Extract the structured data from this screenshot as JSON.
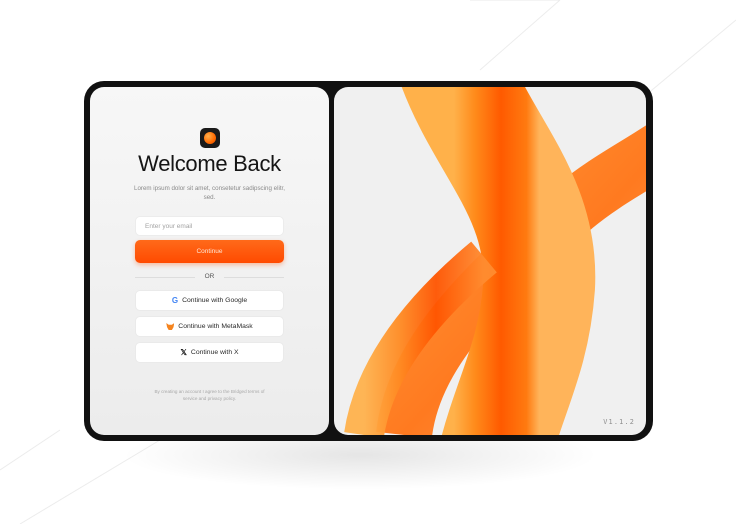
{
  "auth": {
    "title": "Welcome Back",
    "subtitle": "Lorem ipsum dolor sit amet, consetetur sadipscing elitr, sed.",
    "email_placeholder": "Enter your email",
    "continue_label": "Continue",
    "divider_label": "OR",
    "google_label": "Continue with Google",
    "metamask_label": "Continue with MetaMask",
    "x_label": "Continue with X",
    "terms": "By creating an account I agree to the Bridged terms of service and privacy policy."
  },
  "icons": {
    "logo": "orange-orb-icon",
    "google": "google-icon",
    "metamask": "metamask-fox-icon",
    "x": "x-icon"
  },
  "hero": {
    "version": "V1.1.2"
  },
  "colors": {
    "accent": "#ff4a00",
    "frame": "#111111",
    "panel": "#f2f2f2"
  }
}
